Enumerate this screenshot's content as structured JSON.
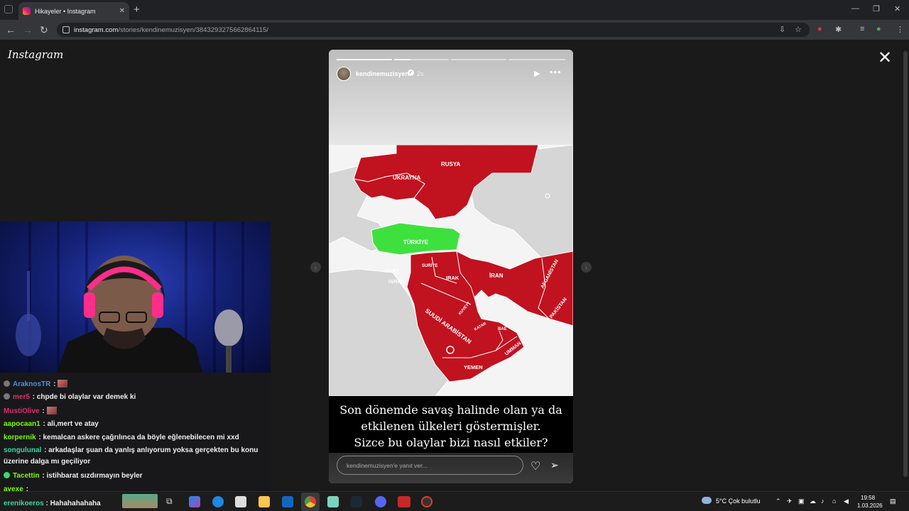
{
  "browser": {
    "tab_title": "Hikayeler • Instagram",
    "url_host": "instagram.com",
    "url_path": "/stories/kendinemuzisyen/3843293275662864115/"
  },
  "instagram": {
    "logo_text": "Instagram",
    "story": {
      "username": "kendinemuzisyen",
      "time": "2s",
      "caption_lines": [
        "Son dönemde savaş halinde olan ya da",
        "etkilenen ülkeleri göstermişler.",
        "Sizce bu olaylar bizi nasıl etkiler?"
      ],
      "reply_placeholder": "kendinemuzisyen'e yanıt ver...",
      "map_labels": {
        "rusya": "RUSYA",
        "ukrayna": "UKRAYNA",
        "turkiye": "TÜRKİYE",
        "suriye": "SURİYE",
        "gkry": "GKRY",
        "israil": "İSRAİL",
        "irak": "IRAK",
        "iran": "İRAN",
        "afganistan": "AFGANİSTAN",
        "pakistan": "PAKİSTAN",
        "kuveyt": "KUVEYT",
        "suudi": "SUUDİ ARABİSTAN",
        "katar": "KATAR",
        "bae": "BAE",
        "umman": "UMMAN",
        "yemen": "YEMEN"
      },
      "colors": {
        "war_red": "#c1121f",
        "turkey_green": "#3ee03e",
        "land_grey": "#d6d6d6"
      }
    }
  },
  "chat": {
    "messages": [
      {
        "user": "AraknosTR",
        "user_color": "#4a90e2",
        "text": ""
      },
      {
        "user": "mer5",
        "user_color": "#d6336c",
        "text": "chpde bi olaylar var demek ki"
      },
      {
        "user": "MustiOlive",
        "user_color": "#d6336c",
        "text": ""
      },
      {
        "user": "aapocaan1",
        "user_color": "#7CFC00",
        "text": "ali,mert ve atay"
      },
      {
        "user": "korpernik",
        "user_color": "#7CFC00",
        "text": "kemalcan askere çağrılınca da böyle eğlenebilecen mi xxd"
      },
      {
        "user": "songulunal",
        "user_color": "#3ad9a0",
        "text": "arkadaşlar şuan da yanlış anlıyorum yoksa gerçekten bu konu üzerine dalga mı geçiliyor"
      },
      {
        "user": "Tacettin",
        "user_color": "#7CFC00",
        "text": "istihbarat sızdırmayın beyler"
      },
      {
        "user": "avexe",
        "user_color": "#7CFC00",
        "text": ""
      },
      {
        "user": "erenikoeros",
        "user_color": "#3ad9a0",
        "text": "Hahahahahaha"
      }
    ]
  },
  "taskbar": {
    "weather": "5°C  Çok bulutlu",
    "time": "19:58",
    "date": "1.03.2026"
  }
}
